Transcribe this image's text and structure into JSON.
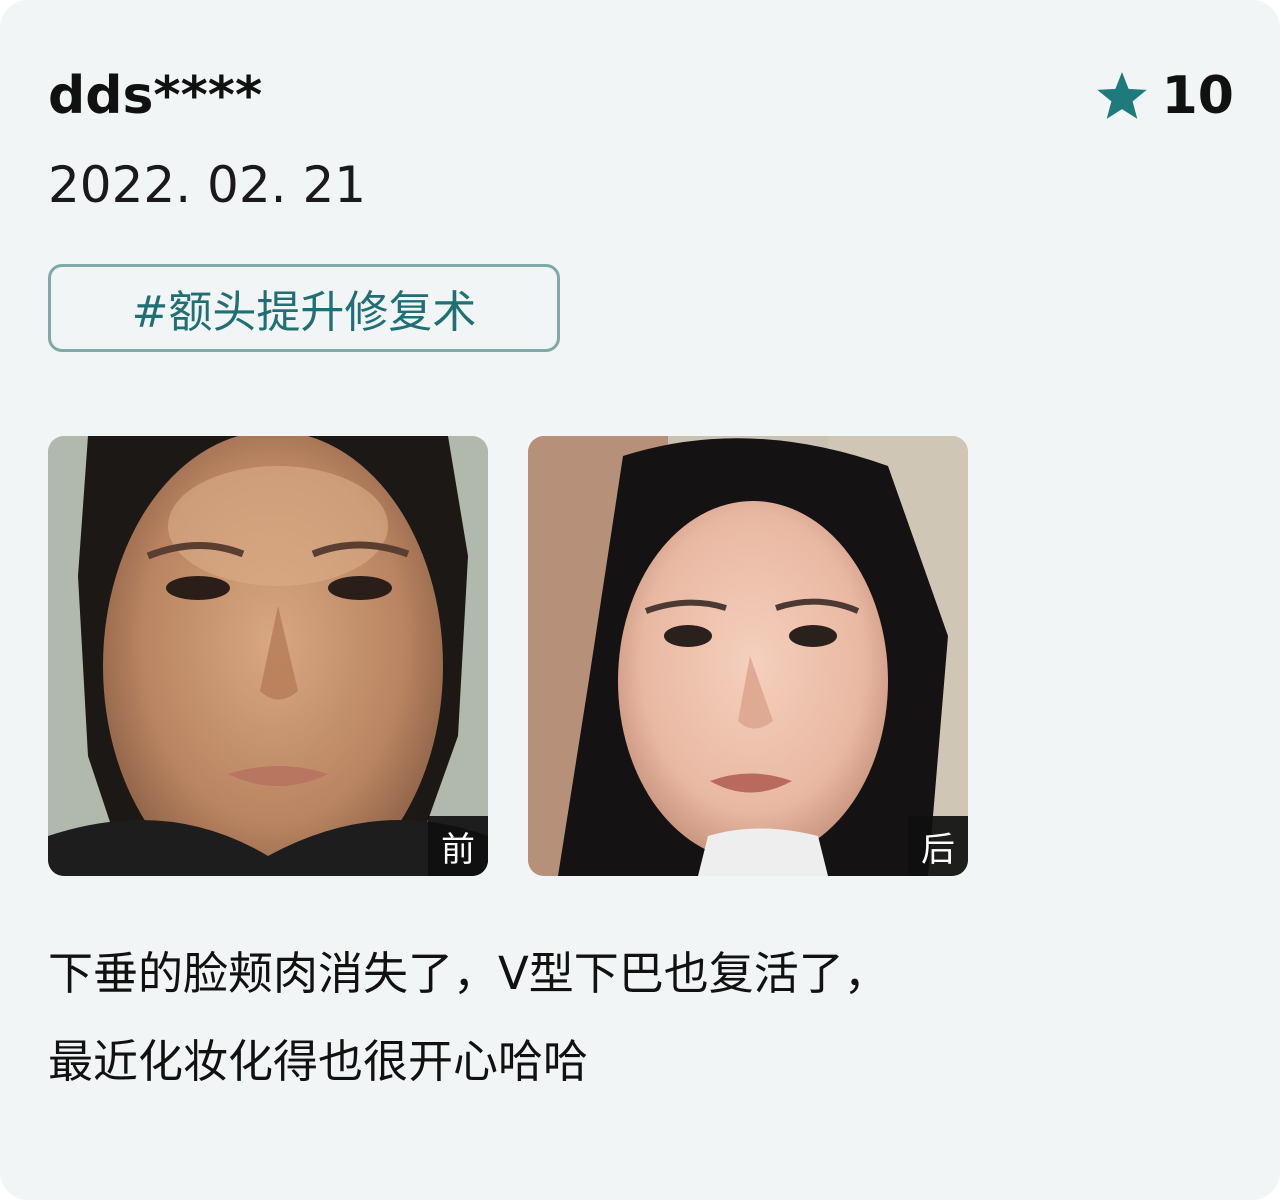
{
  "review": {
    "username": "dds****",
    "rating": {
      "icon": "star-icon",
      "value": "10",
      "color": "#1f7a7c"
    },
    "date": "2022. 02. 21",
    "tag": "#额头提升修复术",
    "photos": [
      {
        "label": "前",
        "subject": "before-photo"
      },
      {
        "label": "后",
        "subject": "after-photo"
      }
    ],
    "text_lines": [
      "下垂的脸颊肉消失了，V型下巴也复活了，",
      "最近化妆化得也很开心哈哈"
    ]
  }
}
